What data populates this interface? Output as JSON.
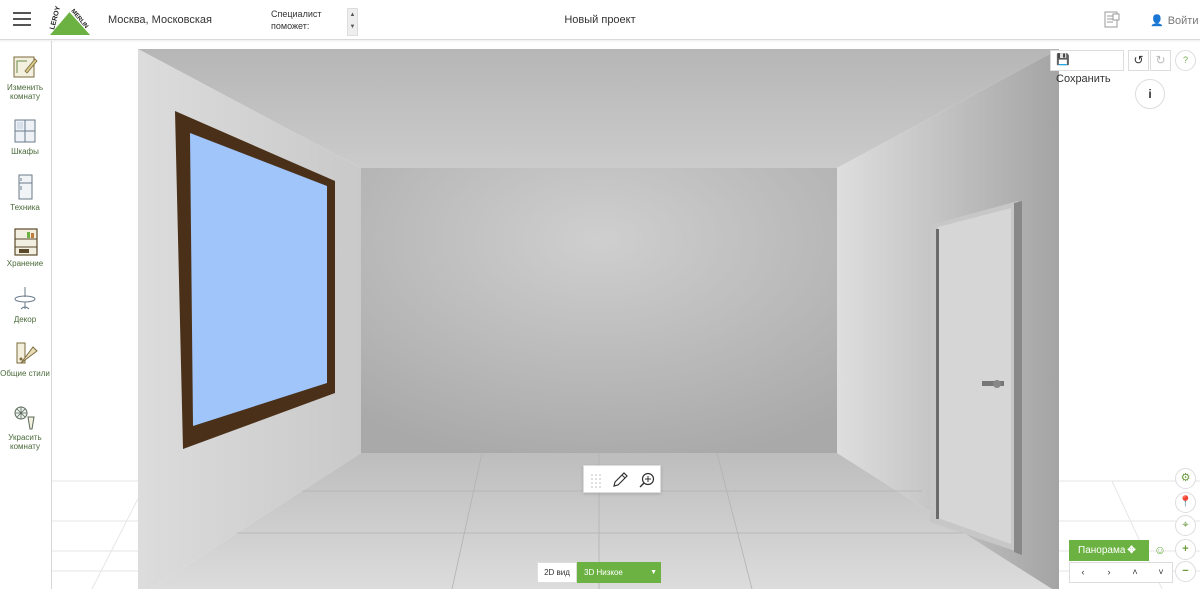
{
  "header": {
    "menu_icon": "hamburger-menu-icon",
    "logo_text": "LEROY MERLIN",
    "city": "Москва, Московская",
    "specialist_text": "Специалист поможет:",
    "project_title": "Новый проект",
    "doc_icon": "document-icon",
    "login_label": "Войти",
    "login_icon": "user-icon"
  },
  "sidebar": {
    "items": [
      {
        "label": "Изменить комнату",
        "icon": "room-edit-icon"
      },
      {
        "label": "Шкафы",
        "icon": "cabinets-icon"
      },
      {
        "label": "Техника",
        "icon": "fridge-icon"
      },
      {
        "label": "Хранение",
        "icon": "storage-icon"
      },
      {
        "label": "Декор",
        "icon": "lamp-icon"
      },
      {
        "label": "Общие стили",
        "icon": "palette-icon"
      },
      {
        "label": "Украсить комнату",
        "icon": "decorate-icon"
      }
    ]
  },
  "toolbar": {
    "save_label": "Сохранить",
    "save_icon": "floppy-disk-icon",
    "undo_icon": "undo-icon",
    "redo_icon": "redo-icon",
    "help_label": "?",
    "info_label": "i"
  },
  "floating_tools": {
    "grid_icon": "grid-icon",
    "pencil_icon": "pencil-icon",
    "zoom_icon": "zoom-in-icon"
  },
  "view_switch": {
    "view_2d_label": "2D вид",
    "view_3d_label": "3D Низкое"
  },
  "navigation": {
    "panorama_label": "Панорама",
    "settings_icon": "gear-icon",
    "location_icon": "map-pin-icon",
    "target_icon": "crosshair-icon",
    "zoom_in_label": "+",
    "zoom_out_label": "−",
    "left_label": "‹",
    "right_label": "›",
    "up_label": "˄",
    "down_label": "˅"
  },
  "colors": {
    "accent": "#6cb242",
    "window_glass": "#9fc5fb",
    "window_frame": "#4a3018"
  }
}
